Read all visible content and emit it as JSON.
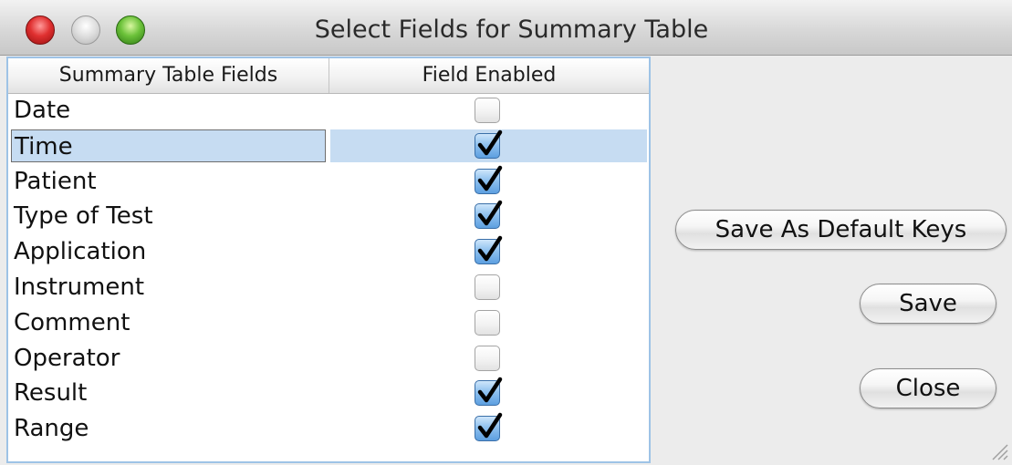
{
  "window": {
    "title": "Select Fields for Summary Table"
  },
  "table": {
    "columns": [
      "Summary Table Fields",
      "Field Enabled"
    ],
    "rows": [
      {
        "label": "Date",
        "enabled": false
      },
      {
        "label": "Time",
        "enabled": true,
        "selected": true
      },
      {
        "label": "Patient",
        "enabled": true
      },
      {
        "label": "Type of Test",
        "enabled": true
      },
      {
        "label": "Application",
        "enabled": true
      },
      {
        "label": "Instrument",
        "enabled": false
      },
      {
        "label": "Comment",
        "enabled": false
      },
      {
        "label": "Operator",
        "enabled": false
      },
      {
        "label": "Result",
        "enabled": true
      },
      {
        "label": "Range",
        "enabled": true
      }
    ]
  },
  "buttons": {
    "save_default_keys": "Save As Default Keys",
    "save": "Save",
    "close": "Close"
  },
  "colors": {
    "selection": "#c6dcf2",
    "table_border": "#9ec3e6",
    "checkmark": "#000000",
    "checked_fill": "#8fc1ef"
  },
  "icons": {
    "close": "close-icon",
    "minimize": "minimize-icon",
    "zoom": "zoom-icon",
    "checkmark": "checkmark-icon",
    "resize": "resize-grip-icon"
  }
}
